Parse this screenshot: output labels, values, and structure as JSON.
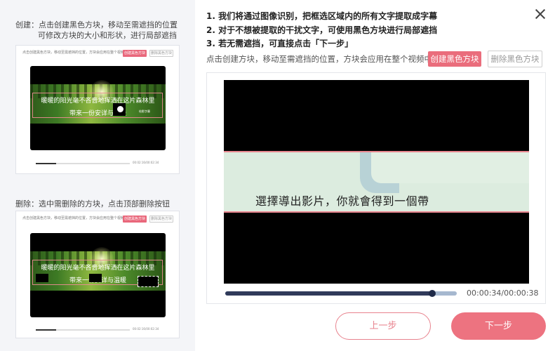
{
  "tutorial": {
    "create_caption_line1": "创建：点击创建黑色方块，移动至需遮挡的位置",
    "create_caption_line2": "可修改方块的大小和形状，进行局部遮挡",
    "delete_caption": "删除：选中需删除的方块，点击顶部删除按钮",
    "demo_hint": "点击创建黑色方块，移动至需遮挡的位置，方块会应用在整个视频中",
    "demo_create_label": "创建黑色方块",
    "demo_delete_label": "删除黑色方块",
    "demo_sub_line1": "暖暖的阳光毫不吝啬地挥洒在这片森林里",
    "demo_sub_line2": "带来一份安详与温暖",
    "demo_watermark": "绘影字幕",
    "demo_time": "00:02:16/00:02:34"
  },
  "steps": [
    "1. 我们将通过图像识别，把框选区域内的所有文字提取成字幕",
    "2. 对于不想被提取的干扰文字，可使用黑色方块进行局部遮挡",
    "3. 若无需遮挡，可直接点击「下一步」"
  ],
  "toolbar": {
    "hint": "点击创建方块，移动至需遮挡的位置，方块会应用在整个视频中",
    "create_label": "创建黑色方块",
    "delete_label": "删除黑色方块"
  },
  "player": {
    "subtitle_text": "選擇導出影片，你就會得到一個帶",
    "time": "00:00:34/00:00:38",
    "progress_fraction": 0.895
  },
  "footer": {
    "prev_label": "上一步",
    "next_label": "下一步"
  },
  "colors": {
    "accent": "#ed7380",
    "selection_line": "#e9868f"
  },
  "icons": {
    "close": "close-icon"
  }
}
